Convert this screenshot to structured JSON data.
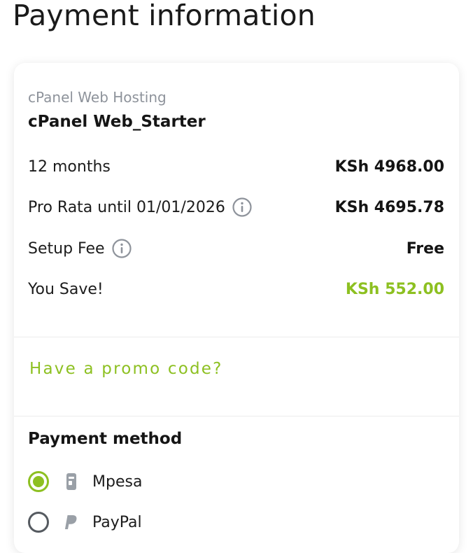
{
  "page": {
    "title": "Payment information"
  },
  "product": {
    "category": "cPanel Web Hosting",
    "name": "cPanel Web_Starter"
  },
  "summary": {
    "rows": [
      {
        "label": "12 months",
        "value": "KSh 4968.00"
      },
      {
        "label": "Pro Rata until 01/01/2026",
        "value": "KSh 4695.78",
        "info_icon": "info-circle-icon"
      },
      {
        "label": "Setup Fee",
        "value": "Free",
        "info_icon": "info-circle-icon"
      },
      {
        "label": "You Save!",
        "value": "KSh 552.00"
      }
    ]
  },
  "promo": {
    "link_label": "Have a promo code?"
  },
  "payment": {
    "heading": "Payment method",
    "methods": [
      {
        "label": "Mpesa",
        "selected": true,
        "icon": "mobile-phone-icon"
      },
      {
        "label": "PayPal",
        "selected": false,
        "icon": "paypal-icon"
      }
    ]
  },
  "colors": {
    "accent": "#8dc021",
    "muted_text": "#8e939b",
    "text": "#151515"
  }
}
